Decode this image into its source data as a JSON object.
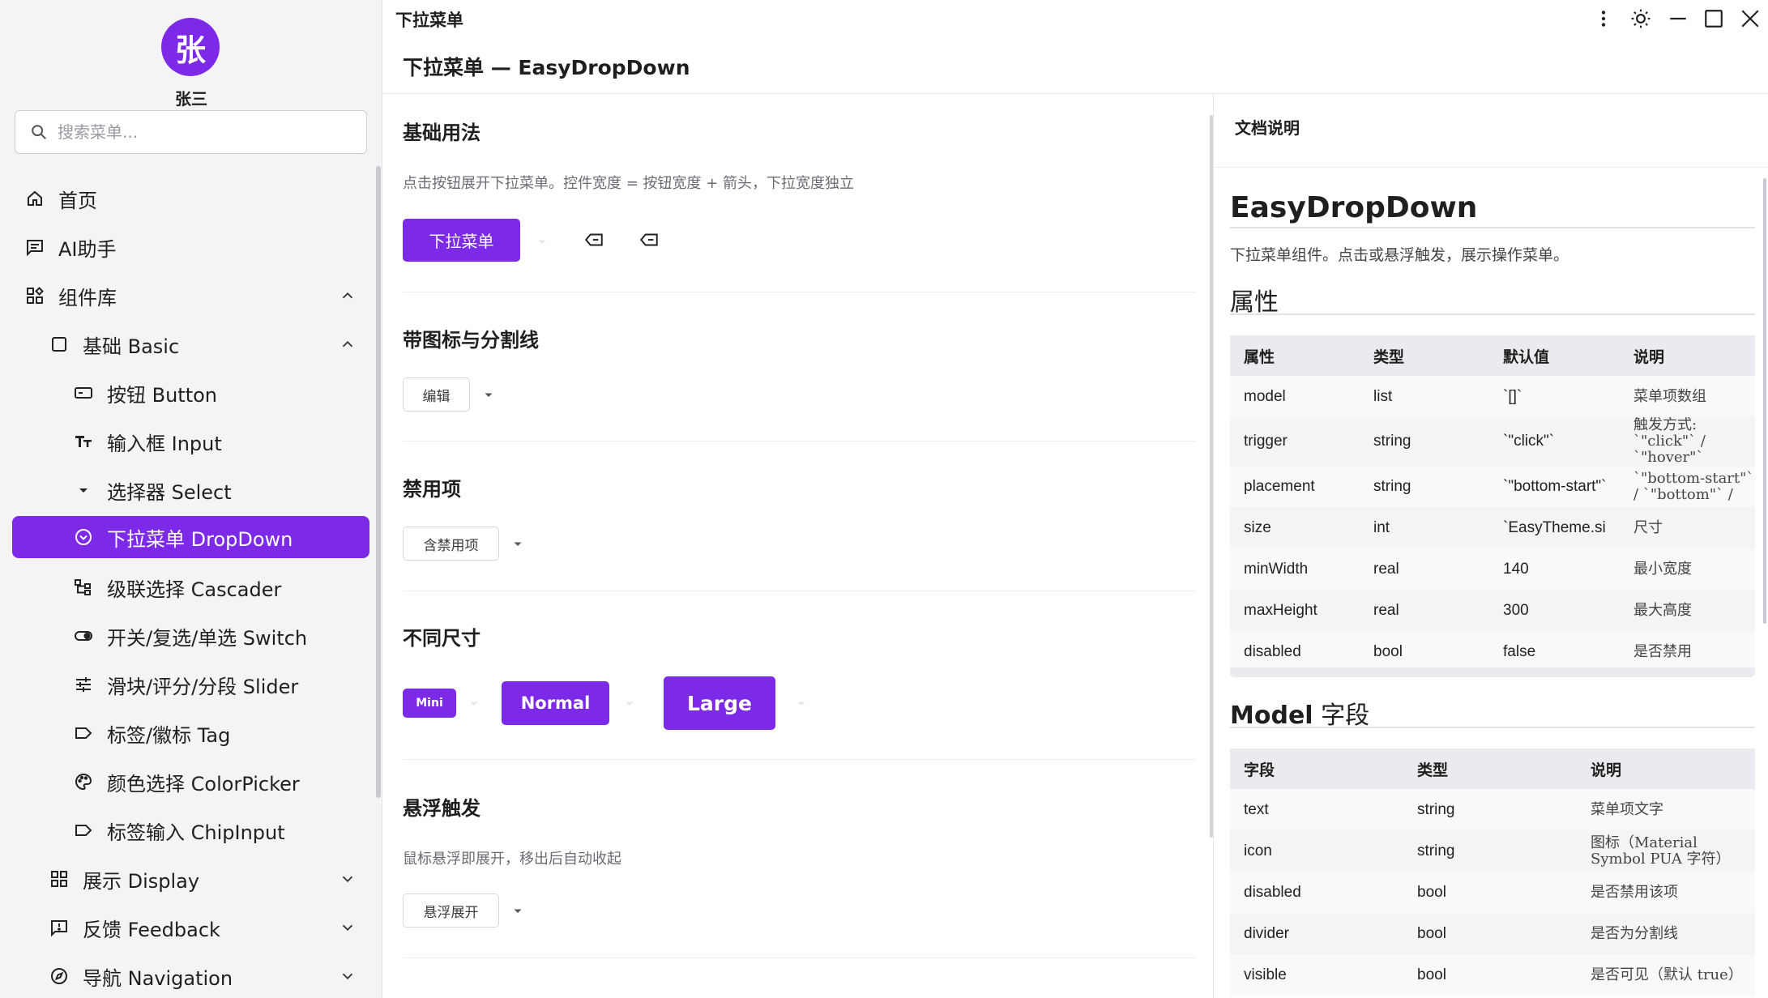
{
  "user": {
    "avatar_char": "张",
    "name": "张三"
  },
  "search": {
    "placeholder": "搜索菜单..."
  },
  "sidebar": {
    "items": [
      {
        "label": "首页",
        "icon": "home-icon"
      },
      {
        "label": "AI助手",
        "icon": "chat-icon"
      },
      {
        "label": "组件库",
        "icon": "widgets-icon",
        "expanded": true
      },
      {
        "label": "基础 Basic",
        "icon": "square-icon",
        "expanded": true
      },
      {
        "label": "按钮 Button",
        "icon": "button-icon"
      },
      {
        "label": "输入框 Input",
        "icon": "text-icon"
      },
      {
        "label": "选择器 Select",
        "icon": "caret-icon"
      },
      {
        "label": "下拉菜单 DropDown",
        "icon": "dropdown-circle-icon",
        "active": true
      },
      {
        "label": "级联选择 Cascader",
        "icon": "tree-icon"
      },
      {
        "label": "开关/复选/单选 Switch",
        "icon": "toggle-icon"
      },
      {
        "label": "滑块/评分/分段 Slider",
        "icon": "sliders-icon"
      },
      {
        "label": "标签/徽标 Tag",
        "icon": "label-icon"
      },
      {
        "label": "颜色选择 ColorPicker",
        "icon": "palette-icon"
      },
      {
        "label": "标签输入 ChipInput",
        "icon": "label-icon"
      },
      {
        "label": "展示 Display",
        "icon": "widgets-icon",
        "expanded": false
      },
      {
        "label": "反馈 Feedback",
        "icon": "feedback-icon",
        "expanded": false
      },
      {
        "label": "导航 Navigation",
        "icon": "compass-icon",
        "expanded": false
      }
    ]
  },
  "window": {
    "title": "下拉菜单"
  },
  "page": {
    "title": "下拉菜单 — EasyDropDown"
  },
  "sections": {
    "basic": {
      "title": "基础用法",
      "desc": "点击按钮展开下拉菜单。控件宽度 = 按钮宽度 + 箭头，下拉宽度独立",
      "button": "下拉菜单"
    },
    "icons": {
      "title": "带图标与分割线",
      "button": "编辑"
    },
    "disabled": {
      "title": "禁用项",
      "button": "含禁用项"
    },
    "sizes": {
      "title": "不同尺寸",
      "mini": "Mini",
      "normal": "Normal",
      "large": "Large"
    },
    "hover": {
      "title": "悬浮触发",
      "desc": "鼠标悬浮即展开，移出后自动收起",
      "button": "悬浮展开"
    }
  },
  "doc": {
    "header": "文档说明",
    "h1": "EasyDropDown",
    "intro": "下拉菜单组件。点击或悬浮触发，展示操作菜单。",
    "props_title": "属性",
    "props_headers": [
      "属性",
      "类型",
      "默认值",
      "说明"
    ],
    "props_rows": [
      [
        "model",
        "list",
        "`[]`",
        "菜单项数组"
      ],
      [
        "trigger",
        "string",
        "`\"click\"`",
        "触发方式: `\"click\"` / `\"hover\"`"
      ],
      [
        "placement",
        "string",
        "`\"bottom-start\"`",
        "`\"bottom-start\"` / `\"bottom\"` /"
      ],
      [
        "size",
        "int",
        "`EasyTheme.si",
        "尺寸"
      ],
      [
        "minWidth",
        "real",
        "140",
        "最小宽度"
      ],
      [
        "maxHeight",
        "real",
        "300",
        "最大高度"
      ],
      [
        "disabled",
        "bool",
        "false",
        "是否禁用"
      ]
    ],
    "model_title_bold": "Model",
    "model_title_rest": " 字段",
    "model_headers": [
      "字段",
      "类型",
      "说明"
    ],
    "model_rows": [
      [
        "text",
        "string",
        "菜单项文字"
      ],
      [
        "icon",
        "string",
        "图标（Material Symbol PUA 字符）"
      ],
      [
        "disabled",
        "bool",
        "是否禁用该项"
      ],
      [
        "divider",
        "bool",
        "是否为分割线"
      ],
      [
        "visible",
        "bool",
        "是否可见（默认 true）"
      ]
    ]
  },
  "colors": {
    "accent": "#7d2ae8",
    "sidebar_bg": "#f4f4f6"
  }
}
